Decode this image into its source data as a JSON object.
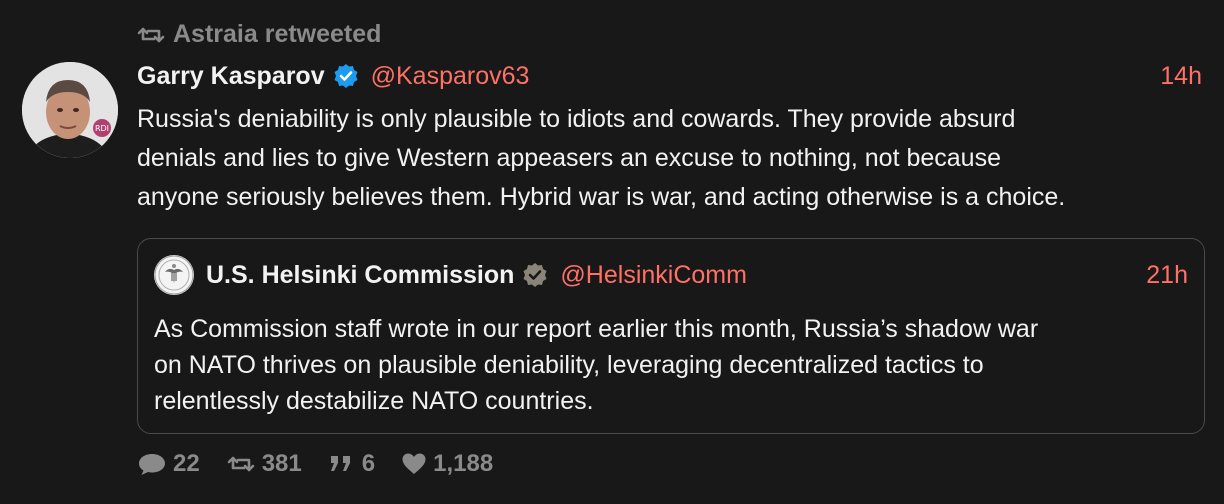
{
  "retweet": {
    "icon": "retweet-icon",
    "text": "Astraia retweeted"
  },
  "tweet": {
    "author": "Garry Kasparov",
    "handle": "@Kasparov63",
    "time": "14h",
    "verified_icon": "verified-badge-icon",
    "body": "Russia's deniability is only plausible to idiots and cowards. They provide absurd\ndenials and lies to give Western appeasers an excuse to nothing, not because\nanyone seriously believes them. Hybrid war is war, and acting otherwise is a choice."
  },
  "quote": {
    "author": "U.S. Helsinki Commission",
    "handle": "@HelsinkiComm",
    "time": "21h",
    "verified_icon": "government-badge-icon",
    "body": "As Commission staff wrote in our report earlier this month, Russia’s shadow war\non NATO thrives on plausible deniability, leveraging decentralized tactics to\nrelentlessly destabilize NATO countries."
  },
  "stats": {
    "replies": "22",
    "retweets": "381",
    "quotes": "6",
    "likes": "1,188"
  },
  "colors": {
    "background": "#181818",
    "accent": "#ff7066",
    "muted": "#8a8a8a",
    "verified": "#1d9bf0",
    "gov_badge": "#8b8478"
  }
}
